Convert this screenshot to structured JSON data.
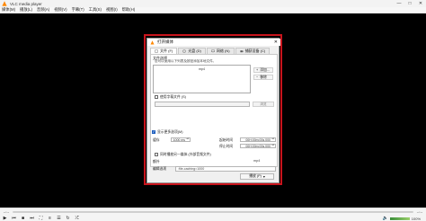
{
  "window": {
    "title": "VLC media player"
  },
  "menubar": [
    "媒体(M)",
    "播放(L)",
    "音频(A)",
    "视频(V)",
    "字幕(T)",
    "工具(S)",
    "视图(I)",
    "帮助(H)"
  ],
  "controls": {
    "time_elapsed": "--:--",
    "time_total": "--:--",
    "volume_pct": "100%"
  },
  "dialog": {
    "title": "打开媒体",
    "tabs": [
      {
        "label": "文件 (F)",
        "icon": "file-icon"
      },
      {
        "label": "光盘 (D)",
        "icon": "disc-icon"
      },
      {
        "label": "网络 (N)",
        "icon": "network-icon"
      },
      {
        "label": "捕获设备 (C)",
        "icon": "capture-icon"
      }
    ],
    "file_group_label": "文件选择",
    "file_group_hint": "您可以使用以下列表及按钮添加本地文件。",
    "file_list_item": "mp4",
    "add_label": "添加...",
    "remove_label": "移除",
    "subtitle_checkbox_label": "使用字幕文件 (S)",
    "browse_label": "浏览",
    "show_more_label": "显示更多选项(M)",
    "caching_label": "缓存",
    "caching_value": "1000 ms",
    "start_time_label": "起始时间",
    "start_time_value": "00H:00m:00s.000",
    "stop_time_label": "停止时间",
    "stop_time_value": "00H:00m:00s.000",
    "sync_play_label": "同时播放另一媒体 (外部音频文件)",
    "extra_label": "额外",
    "extra_value": "mp4",
    "edit_options_label": "编辑选项",
    "edit_options_value": ":file-caching=1000",
    "play_label": "播放 (P)"
  },
  "colors": {
    "highlight_frame": "#c8141c",
    "checkbox_on": "#1f5fbf"
  }
}
